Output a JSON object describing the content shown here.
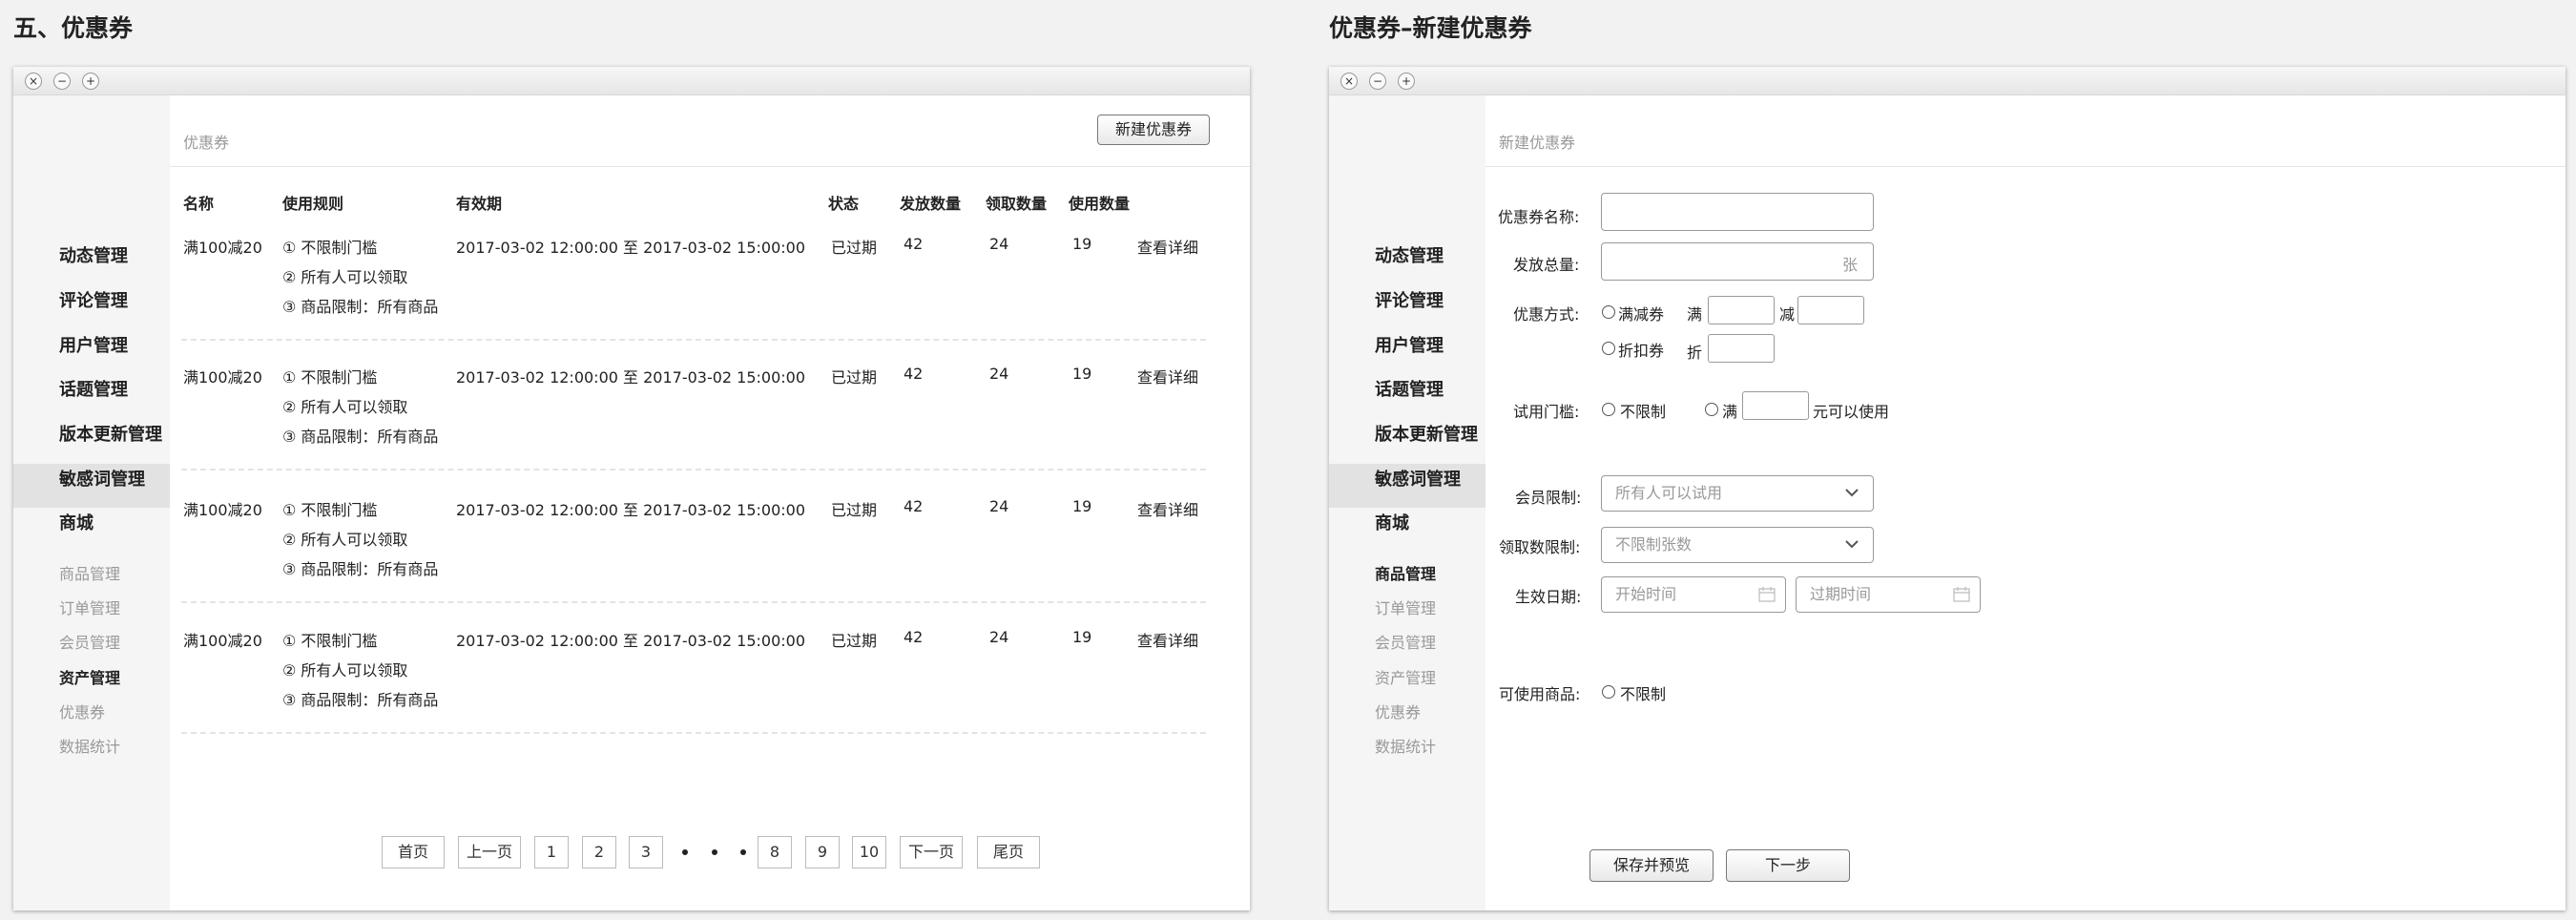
{
  "left": {
    "section_title": "五、优惠券",
    "window_buttons": [
      "×",
      "−",
      "+"
    ],
    "sidebar": {
      "items": [
        "动态管理",
        "评论管理",
        "用户管理",
        "话题管理",
        "版本更新管理",
        "敏感词管理",
        "商城"
      ],
      "sub_items": [
        "商品管理",
        "订单管理",
        "会员管理",
        "资产管理",
        "优惠券",
        "数据统计"
      ]
    },
    "breadcrumb": "优惠券",
    "new_button": "新建优惠券",
    "columns": [
      "名称",
      "使用规则",
      "有效期",
      "状态",
      "发放数量",
      "领取数量",
      "使用数量"
    ],
    "rows": [
      {
        "name": "满100减20",
        "rule1": "① 不限制门槛",
        "rule2": "② 所有人可以领取",
        "rule3": "③ 商品限制：所有商品",
        "period": "2017-03-02 12:00:00 至 2017-03-02 15:00:00",
        "status": "已过期",
        "issued": "42",
        "received": "24",
        "used": "19",
        "action": "查看详细"
      },
      {
        "name": "满100减20",
        "rule1": "① 不限制门槛",
        "rule2": "② 所有人可以领取",
        "rule3": "③ 商品限制：所有商品",
        "period": "2017-03-02 12:00:00 至 2017-03-02 15:00:00",
        "status": "已过期",
        "issued": "42",
        "received": "24",
        "used": "19",
        "action": "查看详细"
      },
      {
        "name": "满100减20",
        "rule1": "① 不限制门槛",
        "rule2": "② 所有人可以领取",
        "rule3": "③ 商品限制：所有商品",
        "period": "2017-03-02 12:00:00 至 2017-03-02 15:00:00",
        "status": "已过期",
        "issued": "42",
        "received": "24",
        "used": "19",
        "action": "查看详细"
      },
      {
        "name": "满100减20",
        "rule1": "① 不限制门槛",
        "rule2": "② 所有人可以领取",
        "rule3": "③ 商品限制：所有商品",
        "period": "2017-03-02 12:00:00 至 2017-03-02 15:00:00",
        "status": "已过期",
        "issued": "42",
        "received": "24",
        "used": "19",
        "action": "查看详细"
      }
    ],
    "pagination": {
      "first": "首页",
      "prev": "上一页",
      "pages": [
        "1",
        "2",
        "3",
        "8",
        "9",
        "10"
      ],
      "next": "下一页",
      "last": "尾页"
    }
  },
  "right": {
    "section_title": "优惠券–新建优惠券",
    "window_buttons": [
      "×",
      "−",
      "+"
    ],
    "sidebar": {
      "items": [
        "动态管理",
        "评论管理",
        "用户管理",
        "话题管理",
        "版本更新管理",
        "敏感词管理",
        "商城"
      ],
      "sub_items": [
        "商品管理",
        "订单管理",
        "会员管理",
        "资产管理",
        "优惠券",
        "数据统计"
      ]
    },
    "breadcrumb": "新建优惠券",
    "form": {
      "name_label": "优惠券名称:",
      "total_label": "发放总量:",
      "total_unit": "张",
      "method_label": "优惠方式:",
      "method_full_reduce": "满减券",
      "full": "满",
      "reduce": "减",
      "method_discount": "折扣券",
      "discount": "折",
      "threshold_label": "试用门槛:",
      "threshold_none": "不限制",
      "threshold_full": "满",
      "threshold_suffix": "元可以使用",
      "member_label": "会员限制:",
      "member_value": "所有人可以试用",
      "claim_label": "领取数限制:",
      "claim_value": "不限制张数",
      "date_label": "生效日期:",
      "start_placeholder": "开始时间",
      "end_placeholder": "过期时间",
      "goods_label": "可使用商品:",
      "goods_none": "不限制"
    },
    "buttons": {
      "save_preview": "保存并预览",
      "next": "下一步"
    }
  },
  "colors": {
    "page_bg": "#f2f2f2",
    "sidebar_bg": "#f5f5f5",
    "sidebar_active": "#e2e2e2",
    "muted_text": "#999999"
  }
}
